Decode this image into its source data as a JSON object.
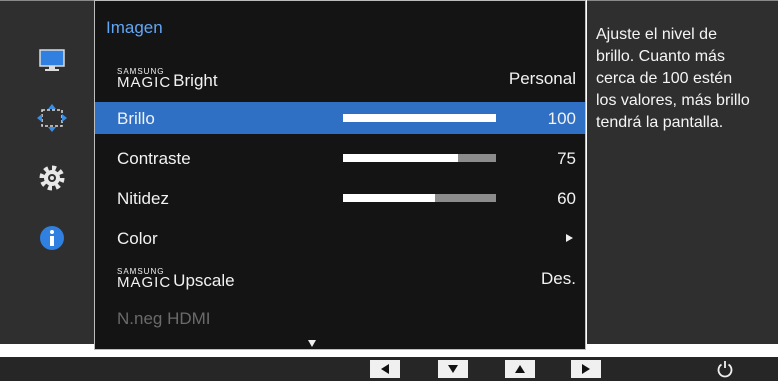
{
  "menu": {
    "title": "Imagen",
    "rows": [
      {
        "brand_small": "SAMSUNG",
        "brand_big": "MAGIC",
        "label": "Bright",
        "value": "Personal"
      },
      {
        "label": "Brillo",
        "value": "100",
        "level": 100,
        "selected": true
      },
      {
        "label": "Contraste",
        "value": "75",
        "level": 75
      },
      {
        "label": "Nitidez",
        "value": "60",
        "level": 60
      },
      {
        "label": "Color",
        "value": ""
      },
      {
        "brand_small": "SAMSUNG",
        "brand_big": "MAGIC",
        "label": "Upscale",
        "value": "Des."
      },
      {
        "label": "N.neg HDMI",
        "value": "",
        "disabled": true
      }
    ]
  },
  "help": {
    "text": "Ajuste el nivel de brillo. Cuanto más cerca de 100 estén los valores, más brillo tendrá la pantalla."
  },
  "icons": {
    "rail": [
      "monitor-icon",
      "resize-icon",
      "gear-icon",
      "info-icon"
    ],
    "bottom": [
      "left-arrow-icon",
      "down-arrow-icon",
      "up-arrow-icon",
      "right-arrow-icon",
      "power-icon"
    ]
  },
  "colors": {
    "accent": "#62a7f5",
    "selection": "#2f6fc4",
    "info": "#2f80e0"
  }
}
